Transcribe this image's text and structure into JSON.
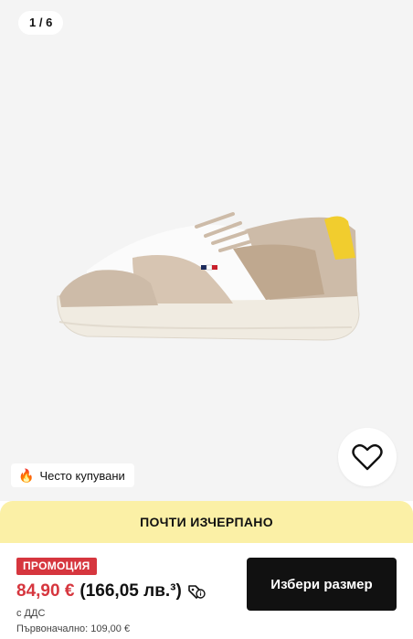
{
  "gallery": {
    "counter": "1 / 6"
  },
  "badge": {
    "icon": "fire-icon",
    "label": "Често купувани"
  },
  "wishlist": {
    "icon": "heart-icon"
  },
  "panel": {
    "stock_banner": "ПОЧТИ ИЗЧЕРПАНО",
    "promo_label": "ПРОМОЦИЯ",
    "price": "84,90 €",
    "converted_price": "(166,05 лв.³)",
    "vat_note": "с ДДС",
    "original_price": "Първоначално: 109,00 €",
    "cta_label": "Избери размер"
  },
  "colors": {
    "promo_red": "#d6363e",
    "stock_yellow": "#fbf0a6",
    "cta_black": "#111111"
  }
}
